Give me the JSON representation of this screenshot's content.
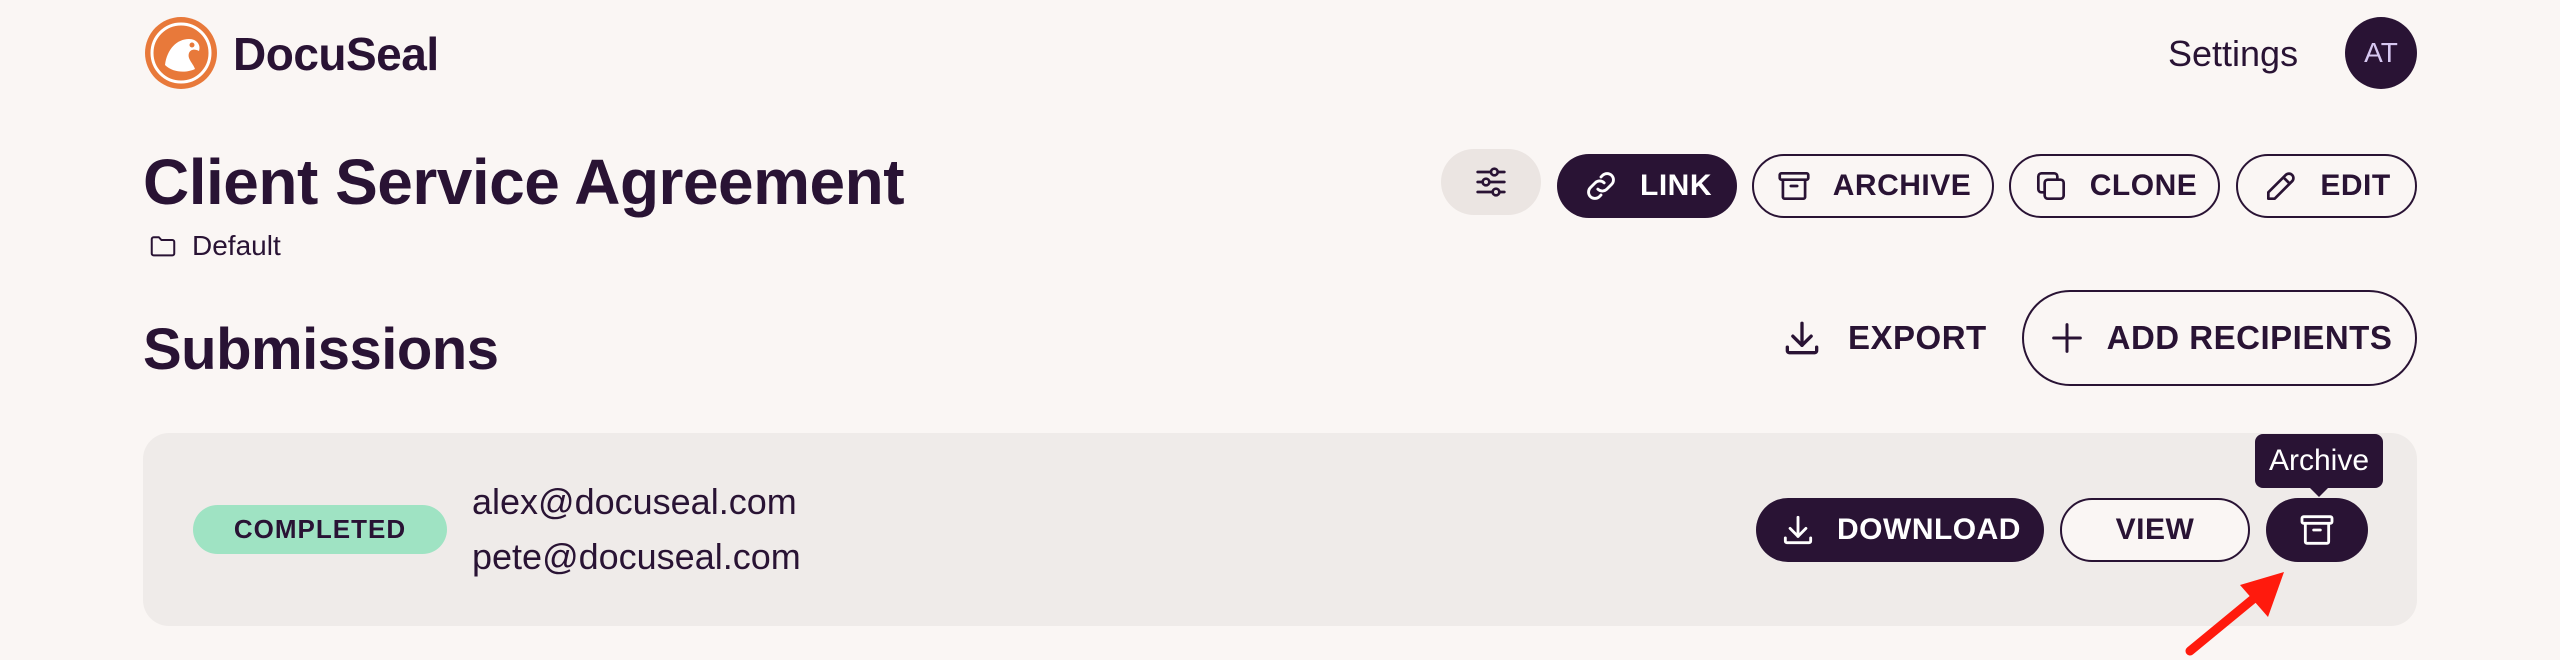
{
  "header": {
    "brand": "DocuSeal",
    "settings_label": "Settings",
    "avatar_initials": "AT"
  },
  "template": {
    "title": "Client Service Agreement",
    "folder": "Default",
    "buttons": {
      "link": "LINK",
      "archive": "ARCHIVE",
      "clone": "CLONE",
      "edit": "EDIT"
    }
  },
  "submissions": {
    "heading": "Submissions",
    "export_label": "EXPORT",
    "add_recipients_label": "ADD RECIPIENTS",
    "rows": [
      {
        "status": "COMPLETED",
        "emails": [
          "alex@docuseal.com",
          "pete@docuseal.com"
        ],
        "download_label": "DOWNLOAD",
        "view_label": "VIEW",
        "archive_tooltip": "Archive"
      }
    ]
  },
  "colors": {
    "background": "#faf6f4",
    "primary": "#291334",
    "brand_orange": "#e8793a",
    "completed_badge": "#9fe3c3",
    "row_background": "#efebe9",
    "annotation_arrow": "#ff1a0d"
  },
  "icons": [
    "docuseal-logo",
    "folder-icon",
    "sliders-icon",
    "link-icon",
    "archive-icon",
    "copy-icon",
    "pencil-icon",
    "download-icon",
    "plus-icon"
  ]
}
